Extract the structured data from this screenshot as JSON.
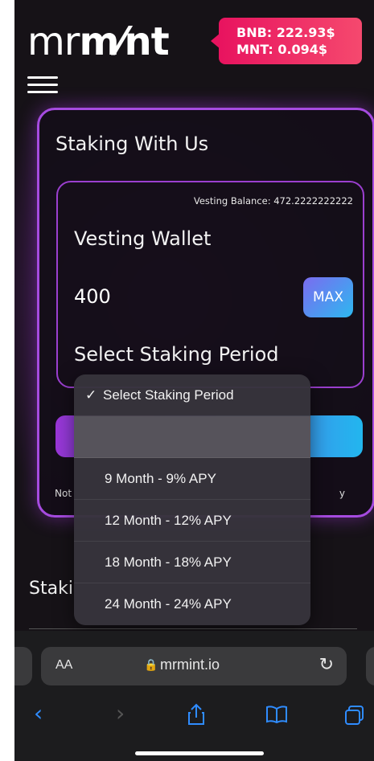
{
  "header": {
    "logo_thin": "mr",
    "logo_bold": "m⁄nt",
    "bnb_price": "BNB: 222.93$",
    "mnt_price": "MNT: 0.094$"
  },
  "card": {
    "title": "Staking With Us",
    "vesting_balance": "Vesting Balance: 472.2222222222",
    "wallet_title": "Vesting Wallet",
    "amount_value": "400",
    "max_label": "MAX",
    "period_select_label": "Select Staking Period",
    "note_left": "Not",
    "note_right": "y"
  },
  "dropdown": {
    "options": [
      {
        "label": "Select Staking Period",
        "checked": true
      },
      {
        "label": "",
        "checked": false
      },
      {
        "label": "9 Month - 9% APY",
        "checked": false
      },
      {
        "label": "12 Month - 12% APY",
        "checked": false
      },
      {
        "label": "18 Month - 18% APY",
        "checked": false
      },
      {
        "label": "24 Month - 24% APY",
        "checked": false
      }
    ],
    "check_glyph": "✓"
  },
  "section": {
    "staking_title": "Staki"
  },
  "browser": {
    "text_size_label": "AA",
    "url": "mrmint.io"
  },
  "icons": {
    "hamburger": "menu-icon",
    "lock": "lock-icon",
    "reload": "reload-icon",
    "back": "back-icon",
    "forward": "forward-icon",
    "share": "share-icon",
    "bookmarks": "bookmarks-icon",
    "tabs": "tabs-icon"
  },
  "colors": {
    "accent_purple": "#a64be0",
    "badge_pink": "#e8135f",
    "ios_blue": "#2f8cff"
  }
}
